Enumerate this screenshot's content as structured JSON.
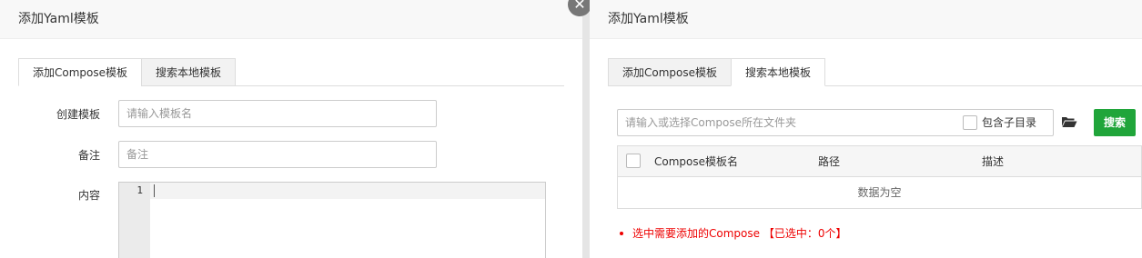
{
  "left_dialog": {
    "title": "添加Yaml模板",
    "tabs": [
      {
        "label": "添加Compose模板",
        "active": true
      },
      {
        "label": "搜索本地模板",
        "active": false
      }
    ],
    "form": {
      "template_label": "创建模板",
      "template_placeholder": "请输入模板名",
      "remark_label": "备注",
      "remark_placeholder": "备注",
      "content_label": "内容",
      "editor_line_number": "1"
    }
  },
  "close_icon": "close-icon",
  "right_dialog": {
    "title": "添加Yaml模板",
    "tabs": [
      {
        "label": "添加Compose模板",
        "active": false
      },
      {
        "label": "搜索本地模板",
        "active": true
      }
    ],
    "search": {
      "placeholder": "请输入或选择Compose所在文件夹",
      "include_subdir_label": "包含子目录",
      "folder_icon": "folder-open-icon",
      "button_label": "搜索"
    },
    "table": {
      "columns": [
        "Compose模板名",
        "路径",
        "描述"
      ],
      "empty_text": "数据为空"
    },
    "selection_note": "选中需要添加的Compose 【已选中：0个】"
  },
  "colors": {
    "accent_green": "#20a53a",
    "warning_red": "#e00000"
  }
}
